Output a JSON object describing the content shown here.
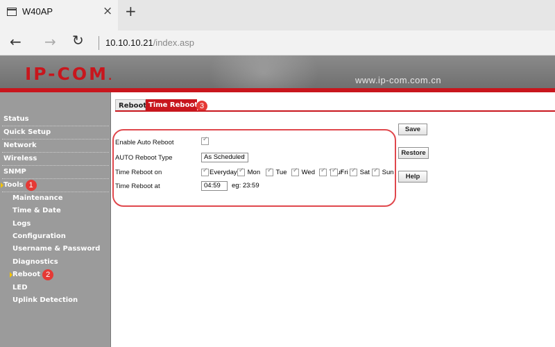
{
  "browser": {
    "tab_title": "W40AP",
    "close_glyph": "×",
    "newtab_glyph": "+",
    "url_host": "10.10.10.21",
    "url_path": "/index.asp",
    "back_glyph": "←",
    "forward_glyph": "→",
    "refresh_glyph": "↻"
  },
  "banner": {
    "logo": "IP-COM",
    "site": "www.ip-com.com.cn",
    "accent": "#c8161d"
  },
  "sidebar": {
    "status": "Status",
    "quick_setup": "Quick Setup",
    "network": "Network",
    "wireless": "Wireless",
    "snmp": "SNMP",
    "tools": "Tools",
    "tools_badge": "1",
    "maintenance": "Maintenance",
    "time_date": "Time & Date",
    "logs": "Logs",
    "configuration": "Configuration",
    "username_password": "Username & Password",
    "diagnostics": "Diagnostics",
    "reboot": "Reboot",
    "reboot_badge": "2",
    "led": "LED",
    "uplink_detection": "Uplink Detection"
  },
  "content_tabs": {
    "reboot": "Reboot",
    "time_reboot": "Time Reboot",
    "badge": "3"
  },
  "form": {
    "enable_label": "Enable Auto Reboot",
    "enable_checked": true,
    "type_label": "AUTO Reboot Type",
    "type_value": "As Scheduled",
    "on_label": "Time Reboot on",
    "days": [
      "Everyday",
      "Mon",
      "Tue",
      "Wed",
      "Thur",
      "Fri",
      "Sat",
      "Sun"
    ],
    "at_label": "Time Reboot at",
    "time_value": "04:59",
    "hint": "eg: 23:59"
  },
  "buttons": {
    "save": "Save",
    "restore": "Restore",
    "help": "Help"
  },
  "icons": {
    "window": "window-icon",
    "caret": "chevron-down-icon"
  }
}
